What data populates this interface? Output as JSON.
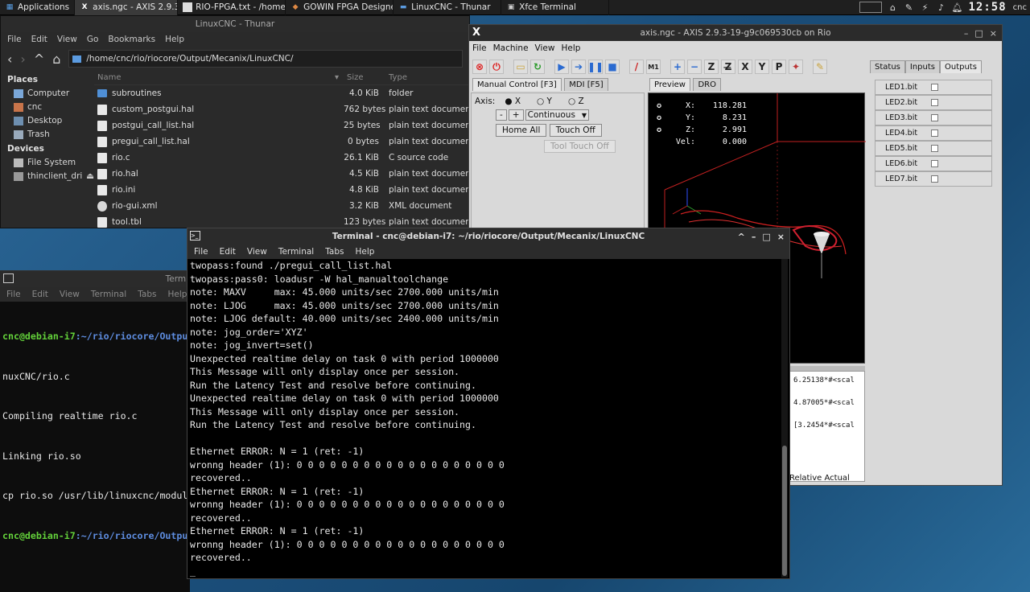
{
  "panel": {
    "apps_label": "Applications",
    "tasks": [
      {
        "label": "axis.ngc - AXIS 2.9.3-19...",
        "icon": "x-icon"
      },
      {
        "label": "RIO-FPGA.txt - /home/c...",
        "icon": "text-editor-icon"
      },
      {
        "label": "GOWIN FPGA Designer",
        "icon": "gowin-icon"
      },
      {
        "label": "LinuxCNC - Thunar",
        "icon": "folder-icon"
      },
      {
        "label": "Xfce Terminal",
        "icon": "terminal-icon"
      }
    ],
    "clock": "12:58",
    "user": "cnc"
  },
  "thunar": {
    "title": "LinuxCNC - Thunar",
    "menu": [
      "File",
      "Edit",
      "View",
      "Go",
      "Bookmarks",
      "Help"
    ],
    "path": "/home/cnc/rio/riocore/Output/Mecanix/LinuxCNC/",
    "places_header": "Places",
    "places": [
      "Computer",
      "cnc",
      "Desktop",
      "Trash"
    ],
    "devices_header": "Devices",
    "devices": [
      "File System",
      "thinclient_dri..."
    ],
    "columns": {
      "name": "Name",
      "size": "Size",
      "type": "Type"
    },
    "files": [
      {
        "name": "subroutines",
        "size": "4.0 KiB",
        "type": "folder",
        "kind": "folder"
      },
      {
        "name": "custom_postgui.hal",
        "size": "762 bytes",
        "type": "plain text document",
        "kind": "text"
      },
      {
        "name": "postgui_call_list.hal",
        "size": "25 bytes",
        "type": "plain text document",
        "kind": "text"
      },
      {
        "name": "pregui_call_list.hal",
        "size": "0 bytes",
        "type": "plain text document",
        "kind": "text"
      },
      {
        "name": "rio.c",
        "size": "26.1 KiB",
        "type": "C source code",
        "kind": "text"
      },
      {
        "name": "rio.hal",
        "size": "4.5 KiB",
        "type": "plain text document",
        "kind": "text"
      },
      {
        "name": "rio.ini",
        "size": "4.8 KiB",
        "type": "plain text document",
        "kind": "text"
      },
      {
        "name": "rio-gui.xml",
        "size": "3.2 KiB",
        "type": "XML document",
        "kind": "xml"
      },
      {
        "name": "tool.tbl",
        "size": "123 bytes",
        "type": "plain text document",
        "kind": "text"
      }
    ]
  },
  "axis": {
    "title": "axis.ngc - AXIS 2.9.3-19-g9c069530cb on Rio",
    "menu": [
      "File",
      "Machine",
      "View",
      "Help"
    ],
    "tabs_left": [
      "Manual Control [F3]",
      "MDI [F5]"
    ],
    "axis_label": "Axis:",
    "axes": [
      "X",
      "Y",
      "Z"
    ],
    "jog_minus": "-",
    "jog_plus": "+",
    "jog_mode": "Continuous",
    "home_all": "Home All",
    "touch_off": "Touch Off",
    "tool_touch_off": "Tool Touch Off",
    "tabs_mid": [
      "Preview",
      "DRO"
    ],
    "dro": [
      {
        "label": "X:",
        "value": "118.281"
      },
      {
        "label": "Y:",
        "value": "8.231"
      },
      {
        "label": "Z:",
        "value": "2.991"
      },
      {
        "label": "Vel:",
        "value": "0.000"
      }
    ],
    "gcode_lines": [
      "6.25138*#<scal",
      "4.87005*#<scal",
      "[3.2454*#<scal"
    ],
    "status_text": "Relative Actual",
    "tabs_right": [
      "Status",
      "Inputs",
      "Outputs"
    ],
    "leds": [
      "LED1.bit",
      "LED2.bit",
      "LED3.bit",
      "LED4.bit",
      "LED5.bit",
      "LED6.bit",
      "LED7.bit"
    ]
  },
  "term2": {
    "title": "Termi",
    "menu": [
      "File",
      "Edit",
      "View",
      "Terminal",
      "Tabs",
      "Help"
    ],
    "prompt_user": "cnc@debian-i7",
    "prompt_path": ":~/rio/riocore/Output",
    "lines": [
      "nuxCNC/rio.c",
      "Compiling realtime rio.c",
      "Linking rio.so",
      "cp rio.so /usr/lib/linuxcnc/module"
    ]
  },
  "term1": {
    "title": "Terminal - cnc@debian-i7: ~/rio/riocore/Output/Mecanix/LinuxCNC",
    "menu": [
      "File",
      "Edit",
      "View",
      "Terminal",
      "Tabs",
      "Help"
    ],
    "lines": [
      "twopass:found ./pregui_call_list.hal",
      "twopass:pass0: loadusr -W hal_manualtoolchange",
      "note: MAXV     max: 45.000 units/sec 2700.000 units/min",
      "note: LJOG     max: 45.000 units/sec 2700.000 units/min",
      "note: LJOG default: 40.000 units/sec 2400.000 units/min",
      "note: jog_order='XYZ'",
      "note: jog_invert=set()",
      "Unexpected realtime delay on task 0 with period 1000000",
      "This Message will only display once per session.",
      "Run the Latency Test and resolve before continuing.",
      "Unexpected realtime delay on task 0 with period 1000000",
      "This Message will only display once per session.",
      "Run the Latency Test and resolve before continuing.",
      "",
      "Ethernet ERROR: N = 1 (ret: -1)",
      "wronng header (1): 0 0 0 0 0 0 0 0 0 0 0 0 0 0 0 0 0 0 0",
      "recovered..",
      "Ethernet ERROR: N = 1 (ret: -1)",
      "wronng header (1): 0 0 0 0 0 0 0 0 0 0 0 0 0 0 0 0 0 0 0",
      "recovered..",
      "Ethernet ERROR: N = 1 (ret: -1)",
      "wronng header (1): 0 0 0 0 0 0 0 0 0 0 0 0 0 0 0 0 0 0 0",
      "recovered..",
      "_"
    ]
  }
}
